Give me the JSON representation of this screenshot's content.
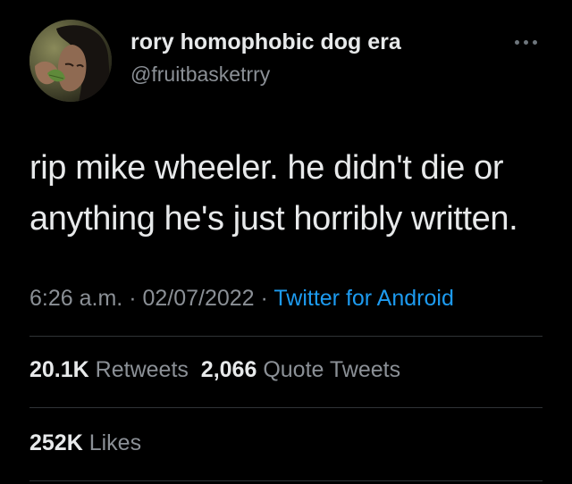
{
  "author": {
    "display_name": "rory homophobic dog era",
    "handle": "@fruitbasketrry",
    "avatar_icon": "profile-photo"
  },
  "menu_icon": "more-horizontal-icon",
  "tweet": {
    "lines": [
      "rip mike wheeler. he didn't die or",
      "anything he's just horribly written."
    ]
  },
  "meta": {
    "time": "6:26 a.m.",
    "separator": "·",
    "date": "02/07/2022",
    "source": "Twitter for Android"
  },
  "stats": {
    "retweets_count": "20.1K",
    "retweets_label": "Retweets",
    "quotes_count": "2,066",
    "quotes_label": "Quote Tweets",
    "likes_count": "252K",
    "likes_label": "Likes"
  },
  "colors": {
    "background": "#000000",
    "primary_text": "#e7e9ea",
    "secondary_text": "#8b9096",
    "link": "#1d9bf0",
    "divider": "#2f3336"
  }
}
